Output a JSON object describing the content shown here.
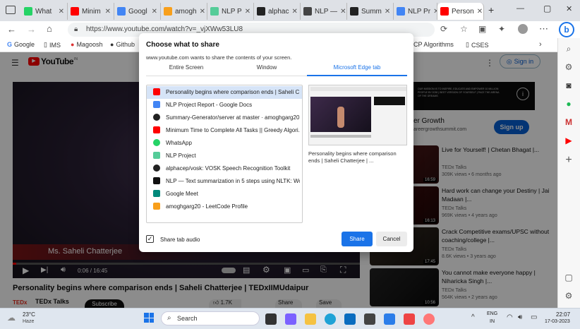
{
  "tabs": [
    {
      "label": "",
      "icon": "window-menu-icon"
    },
    {
      "label": "What",
      "icon": "whatsapp-icon",
      "color": "#25d366"
    },
    {
      "label": "Minim",
      "icon": "youtube-icon",
      "color": "#ff0000"
    },
    {
      "label": "Googl",
      "icon": "google-docs-icon",
      "color": "#4285f4"
    },
    {
      "label": "amogh",
      "icon": "leetcode-icon",
      "color": "#f89f1b"
    },
    {
      "label": "NLP P",
      "icon": "nlp-icon",
      "color": "#5c9"
    },
    {
      "label": "alphac",
      "icon": "github-icon",
      "color": "#222"
    },
    {
      "label": "NLP —",
      "icon": "doc-icon",
      "color": "#444"
    },
    {
      "label": "Summ",
      "icon": "github-icon",
      "color": "#222"
    },
    {
      "label": "NLP Pr",
      "icon": "google-docs-icon",
      "color": "#4285f4"
    },
    {
      "label": "Person",
      "icon": "youtube-icon",
      "color": "#ff0000"
    }
  ],
  "new_tab": "+",
  "window_controls": {
    "minimize": "—",
    "maximize": "▢",
    "close": "✕"
  },
  "address": {
    "url": "https://www.youtube.com/watch?v=_vjXWw53LU8"
  },
  "bookmarks": [
    {
      "label": "Google"
    },
    {
      "label": "IMS"
    },
    {
      "label": "Magoosh"
    },
    {
      "label": "Github"
    },
    {
      "label": "CP Algorithms"
    },
    {
      "label": "CSES"
    }
  ],
  "youtube": {
    "logo": "YouTube",
    "logo_sup": "IN",
    "signin": "Sign in",
    "video_title": "Personality begins where comparison ends | Saheli Chatterjee | TEDxIIMUdaipur",
    "speaker_caption": "Ms. Saheli Chatterjee",
    "time": "0:06 / 16:45",
    "channel": "TEDx Talks",
    "subscribe": "Subscribe",
    "likes": "1.7K",
    "share": "Share",
    "save": "Save",
    "ad_title": "er Growth",
    "ad_url": "areergrowthsummit.com",
    "ad_signup": "Sign up",
    "ad_banner": "OUR MISSION IS TO INSPIRE, EDUCATE AND EMPOWER 10 MILLION PEOPLE BY 2030 | BEST VERSION OF YOURSELF | PACE THE ARENA OF THE DREAMS",
    "suggestions": [
      {
        "title": "Live for Yourself! | Chetan Bhagat |...",
        "channel": "TEDx Talks",
        "meta": "309K views • 6 months ago",
        "duration": "16:59"
      },
      {
        "title": "Hard work can change your Destiny | Jai Madaan |...",
        "channel": "TEDx Talks",
        "meta": "969K views • 4 years ago",
        "duration": "16:13"
      },
      {
        "title": "Crack Competitive exams/UPSC without coaching/college |...",
        "channel": "TEDx Talks",
        "meta": "8.6K views • 3 years ago",
        "duration": "17:45"
      },
      {
        "title": "You cannot make everyone happy | Niharicka Singh |...",
        "channel": "TEDx Talks",
        "meta": "564K views • 2 years ago",
        "duration": "10:56"
      }
    ]
  },
  "dialog": {
    "title": "Choose what to share",
    "subtitle": "www.youtube.com wants to share the contents of your screen.",
    "tabs": [
      "Entire Screen",
      "Window",
      "Microsoft Edge tab"
    ],
    "sources": [
      {
        "label": "Personality begins where comparison ends | Saheli C...",
        "icon": "youtube-icon",
        "color": "#ff0000"
      },
      {
        "label": "NLP Project Report - Google Docs",
        "icon": "google-docs-icon",
        "color": "#4285f4"
      },
      {
        "label": "Summary-Generator/server at master · amoghgarg20...",
        "icon": "github-icon",
        "color": "#222"
      },
      {
        "label": "Minimum Time to Complete All Tasks || Greedy Algori...",
        "icon": "youtube-icon",
        "color": "#ff0000"
      },
      {
        "label": "WhatsApp",
        "icon": "whatsapp-icon",
        "color": "#25d366"
      },
      {
        "label": "NLP Project",
        "icon": "nlp-icon",
        "color": "#5c9"
      },
      {
        "label": "alphacep/vosk: VOSK Speech Recognition Toolkit",
        "icon": "github-icon",
        "color": "#222"
      },
      {
        "label": "NLP — Text summarization in 5 steps using NLTK: Wo...",
        "icon": "medium-icon",
        "color": "#111"
      },
      {
        "label": "Google Meet",
        "icon": "google-meet-icon",
        "color": "#00897b"
      },
      {
        "label": "amoghgarg20 - LeetCode Profile",
        "icon": "leetcode-icon",
        "color": "#f89f1b"
      }
    ],
    "preview_caption": "Personality begins where comparison ends | Saheli Chatterjee | ...",
    "share_audio": "Share tab audio",
    "share_button": "Share",
    "cancel_button": "Cancel"
  },
  "taskbar": {
    "weather_temp": "23°C",
    "weather_desc": "Haze",
    "search": "Search",
    "lang": "ENG",
    "lang2": "IN",
    "time": "22:07",
    "date": "17-03-2023"
  }
}
